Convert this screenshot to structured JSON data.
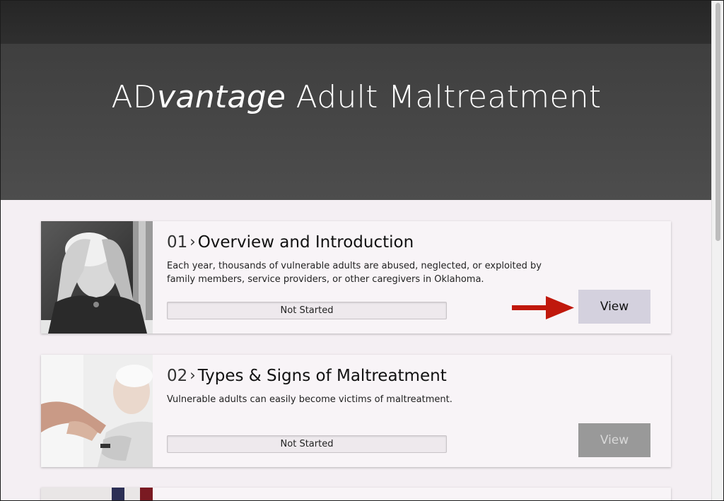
{
  "hero": {
    "title_prefix": "AD",
    "title_italic": "vantage",
    "title_rest": " Adult Maltreatment"
  },
  "modules": [
    {
      "number": "01",
      "title": "Overview and Introduction",
      "description": "Each year, thousands of vulnerable adults are abused, neglected, or exploited by family members, service providers, or other caregivers in Oklahoma.",
      "status": "Not Started",
      "view_label": "View",
      "view_state": "active",
      "image": "elderly-person-distressed-photo"
    },
    {
      "number": "02",
      "title": "Types & Signs of Maltreatment",
      "description": "Vulnerable adults can easily become victims of maltreatment.",
      "status": "Not Started",
      "view_label": "View",
      "view_state": "disabled",
      "image": "elderly-woman-smiling-photo"
    }
  ],
  "annotation": {
    "arrow_color": "#c0180c",
    "icon": "right-arrow-icon"
  },
  "colors": {
    "hero_bg": "#474747",
    "topbar_bg": "#2a2a2a",
    "content_bg": "#f4eff3",
    "view_active": "#d4d1de",
    "view_disabled": "#999999"
  }
}
